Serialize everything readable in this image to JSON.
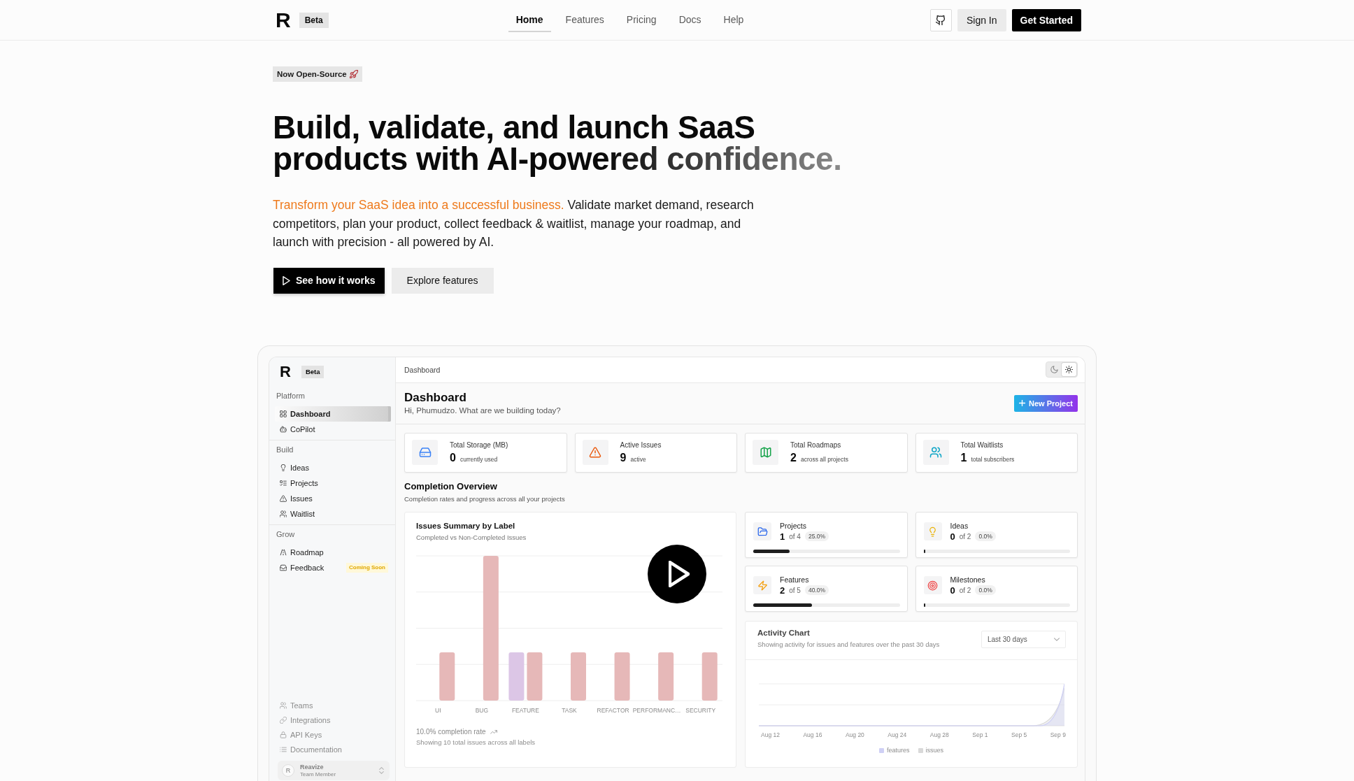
{
  "header": {
    "brand": {
      "logo": "R",
      "badge": "Beta"
    },
    "nav": [
      {
        "label": "Home",
        "selected": true
      },
      {
        "label": "Features",
        "selected": false
      },
      {
        "label": "Pricing",
        "selected": false
      },
      {
        "label": "Docs",
        "selected": false
      },
      {
        "label": "Help",
        "selected": false
      }
    ],
    "actions": [
      {
        "label": "Sign In",
        "kind": "secondary"
      },
      {
        "label": "Get Started",
        "kind": "primary"
      }
    ]
  },
  "hero": {
    "badge": "Now Open-Source",
    "headline": {
      "lead": "Build, validate, and launch SaaS products with",
      "accent": "AI-powered confidence."
    },
    "description": {
      "accent": "Transform your SaaS idea into a successful business.",
      "text": "Validate market demand, research competitors, plan your product, collect feedback & waitlist, manage your roadmap, and launch with precision - all powered by AI."
    },
    "buttons": [
      {
        "label": "See how it works",
        "kind": "primary"
      },
      {
        "label": "Explore features",
        "kind": "secondary"
      }
    ]
  },
  "preview": {
    "sidebar": {
      "brand": {
        "logo": "R",
        "badge": "Beta"
      },
      "groups": [
        {
          "title": "Platform",
          "items": [
            {
              "label": "Dashboard",
              "selected": true
            },
            {
              "label": "CoPilot",
              "selected": false
            }
          ]
        },
        {
          "title": "Build",
          "items": [
            {
              "label": "Ideas",
              "selected": false
            },
            {
              "label": "Projects",
              "selected": false
            },
            {
              "label": "Issues",
              "selected": false
            },
            {
              "label": "Waitlist",
              "selected": false
            }
          ]
        },
        {
          "title": "Grow",
          "items": [
            {
              "label": "Roadmap",
              "selected": false
            },
            {
              "label": "Feedback",
              "selected": false,
              "badge": "Coming Soon"
            }
          ]
        }
      ],
      "footer_items": [
        "Teams",
        "Integrations",
        "API Keys",
        "Documentation"
      ],
      "user": {
        "initial": "R",
        "name": "Reavize",
        "role": "Team Member"
      }
    },
    "topbar": {
      "breadcrumb": "Dashboard",
      "theme_toggle": [
        {
          "selected": false
        },
        {
          "selected": true
        }
      ]
    },
    "page_header": {
      "title": "Dashboard",
      "subtitle": "Hi, Phumudzo. What are we building today?",
      "action": "New Project"
    },
    "stats": [
      {
        "title": "Total Storage (MB)",
        "value": "0",
        "caption": "currently used"
      },
      {
        "title": "Active Issues",
        "value": "9",
        "caption": "active"
      },
      {
        "title": "Total Roadmaps",
        "value": "2",
        "caption": "across all projects"
      },
      {
        "title": "Total Waitlists",
        "value": "1",
        "caption": "total subscribers"
      }
    ],
    "completion": {
      "title": "Completion Overview",
      "subtitle": "Completion rates and progress across all your projects",
      "issues_card": {
        "title": "Issues Summary by Label",
        "subtitle": "Completed vs Non-Completed Issues",
        "x_labels": [
          "UI",
          "BUG",
          "FEATURE",
          "TASK",
          "REFACTOR",
          "PERFORMANC…",
          "SECURITY"
        ],
        "rate": "10.0% completion rate",
        "note": "Showing 10 total issues across all labels"
      },
      "progress_cards": [
        {
          "title": "Projects",
          "count": "1",
          "of": "of 4",
          "percent": "25.0%",
          "level": 0.25
        },
        {
          "title": "Ideas",
          "count": "0",
          "of": "of 2",
          "percent": "0.0%",
          "level": 0
        },
        {
          "title": "Features",
          "count": "2",
          "of": "of 5",
          "percent": "40.0%",
          "level": 0.4
        },
        {
          "title": "Milestones",
          "count": "0",
          "of": "of 2",
          "percent": "0.0%",
          "level": 0
        }
      ],
      "activity_card": {
        "title": "Activity Chart",
        "subtitle": "Showing activity for issues and features over the past 30 days",
        "range": "Last 30 days",
        "x_labels": [
          "Aug 12",
          "Aug 16",
          "Aug 20",
          "Aug 24",
          "Aug 28",
          "Sep 1",
          "Sep 5",
          "Sep 9"
        ],
        "legend": [
          {
            "label": "features",
            "color": "#cfd0f5"
          },
          {
            "label": "issues",
            "color": "#d9d9d9"
          }
        ]
      }
    }
  }
}
